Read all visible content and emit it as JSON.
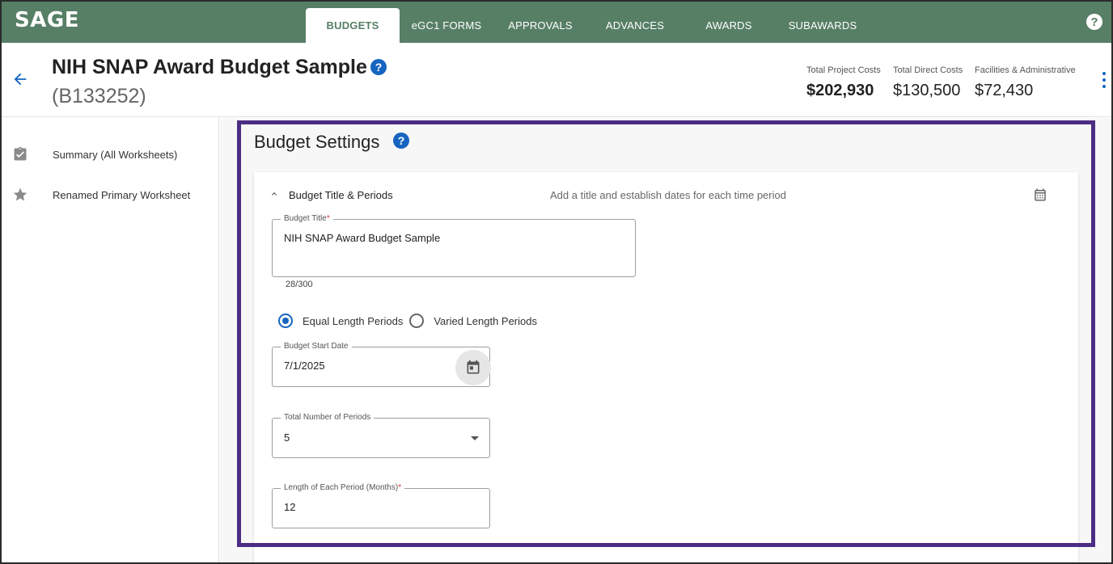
{
  "app": {
    "logo": "SAGE"
  },
  "nav": {
    "tabs": [
      {
        "label": "BUDGETS",
        "active": true
      },
      {
        "label": "eGC1 FORMS"
      },
      {
        "label": "APPROVALS"
      },
      {
        "label": "ADVANCES"
      },
      {
        "label": "AWARDS"
      },
      {
        "label": "SUBAWARDS"
      }
    ],
    "help_glyph": "?"
  },
  "header": {
    "title": "NIH SNAP Award Budget Sample",
    "budget_id": "(B133252)",
    "help_glyph": "?",
    "stats": [
      {
        "label": "Total Project Costs",
        "value": "$202,930"
      },
      {
        "label": "Total Direct Costs",
        "value": "$130,500"
      },
      {
        "label": "Facilities & Administrative",
        "value": "$72,430"
      }
    ]
  },
  "sidebar": {
    "items": [
      {
        "label": "Summary (All Worksheets)",
        "icon": "clipboard-check-icon"
      },
      {
        "label": "Renamed Primary Worksheet",
        "icon": "star-icon"
      }
    ]
  },
  "main": {
    "section_title": "Budget Settings",
    "help_glyph": "?",
    "card": {
      "title": "Budget Title & Periods",
      "subtitle": "Add a title and establish dates for each time period",
      "budget_title": {
        "label": "Budget Title",
        "required_mark": "*",
        "value": "NIH SNAP Award Budget Sample",
        "counter": "28/300"
      },
      "period_type": {
        "options": [
          "Equal Length Periods",
          "Varied Length Periods"
        ],
        "selected": "Equal Length Periods"
      },
      "start_date": {
        "label": "Budget Start Date",
        "value": "7/1/2025"
      },
      "num_periods": {
        "label": "Total Number of Periods",
        "value": "5"
      },
      "period_length": {
        "label": "Length of Each Period (Months)",
        "required_mark": "*",
        "value": "12"
      }
    }
  },
  "colors": {
    "topbar": "#577f66",
    "accent_blue": "#1565c0",
    "highlight": "#4b2e83"
  }
}
